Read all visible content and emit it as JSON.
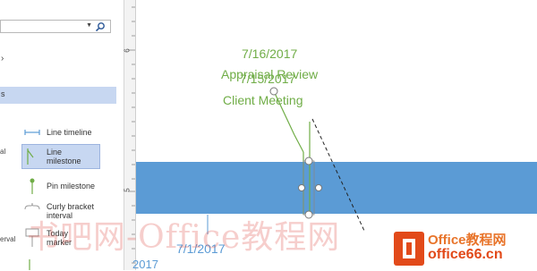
{
  "pane": {
    "search": {
      "placeholder": ""
    },
    "fragments": {
      "top_mark": "s",
      "left_s": "s",
      "left_al": "al",
      "left_erval": "erval"
    },
    "items": [
      {
        "label": "Line timeline"
      },
      {
        "label": "Line\nmilestone"
      },
      {
        "label": "Pin milestone"
      },
      {
        "label": "Curly bracket\ninterval"
      },
      {
        "label": "Today\nmarker"
      }
    ]
  },
  "ruler": {
    "numbers": [
      "6",
      "5"
    ]
  },
  "canvas": {
    "milestone_1": {
      "date": "7/16/2017",
      "name": "Appraisal Review"
    },
    "milestone_2": {
      "date": "7/15/2017",
      "name": "Client Meeting"
    },
    "timeline_date": "7/1/2017",
    "partial_date": "2017",
    "colors": {
      "band": "#5b9bd5",
      "milestone_text": "#70ad47",
      "date_text": "#5b9bd5"
    }
  },
  "watermark": {
    "chinese": "书吧网-Office教程网",
    "brand": "Office教程网",
    "url": "office66.cn"
  }
}
